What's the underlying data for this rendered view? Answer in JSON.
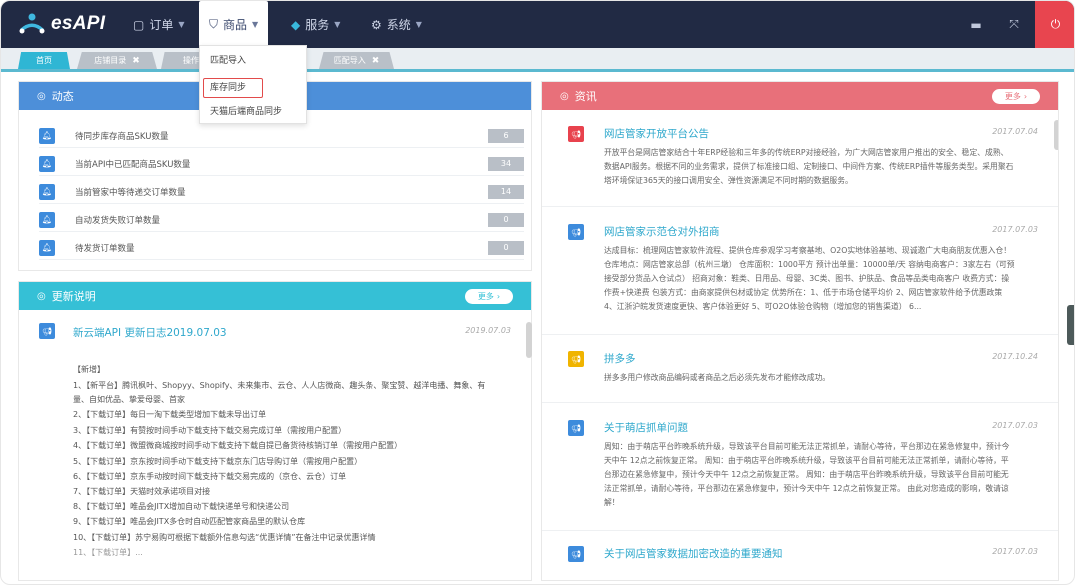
{
  "app": {
    "title": "esAPI"
  },
  "nav": {
    "orders": "订单",
    "goods": "商品",
    "services": "服务",
    "system": "系统"
  },
  "tabs": {
    "home": "首页",
    "shop": "店铺目录",
    "op": "操作",
    "match": "匹配导入"
  },
  "goods_menu": {
    "items": [
      "匹配导入",
      "库存同步",
      "天猫后端商品同步"
    ]
  },
  "dynamic": {
    "title": "动态",
    "rows": [
      {
        "label": "待同步库存商品SKU数量",
        "count": "6"
      },
      {
        "label": "当前API中已匹配商品SKU数量",
        "count": "34"
      },
      {
        "label": "当前管家中等待递交订单数量",
        "count": "14"
      },
      {
        "label": "自动发货失败订单数量",
        "count": "0"
      },
      {
        "label": "待发货订单数量",
        "count": "0"
      }
    ]
  },
  "changelog": {
    "title": "更新说明",
    "more": "更多",
    "entry_title": "新云端API 更新日志2019.07.03",
    "entry_date": "2019.07.03",
    "lines": [
      "【新增】",
      "1、【新平台】腾讯枫叶、Shopyy、Shopify、未来集市、云仓、人人店微商、趣头条、聚宝赞、越洋电播、舞象、有",
      "量、自如优品、挚爱母婴、首家",
      "2、【下载订单】每日一淘下载类型增加下载未导出订单",
      "3、【下载订单】有赞按时间手动下载支持下载交易完成订单（需按用户配置）",
      "4、【下载订单】微盟微商城按时间手动下载支持下载自提已备货待核销订单（需按用户配置）",
      "5、【下载订单】京东按时间手动下载支持下载京东门店导购订单（需按用户配置）",
      "6、【下载订单】京东手动按时间下载支持下载交易完成的（京仓、云仓）订单",
      "7、【下载订单】天猫时效承诺项目对接",
      "8、【下载订单】唯品会JITX增加自动下载快递单号和快递公司",
      "9、【下载订单】唯品会JITX多仓时自动匹配管家商品里的默认仓库",
      "10、【下载订单】苏宁易购可根据下载额外信息勾选“优惠详情”在备注中记录优惠详情",
      "11、【下载订单】..."
    ]
  },
  "news": {
    "title": "资讯",
    "more": "更多",
    "items": [
      {
        "title": "网店管家开放平台公告",
        "date": "2017.07.04",
        "color": "#e8424d",
        "lines": [
          "开放平台是网店管家结合十年ERP经验和三年多的传统ERP对接经验，为广大网店管家用户推出的安全、稳定、成熟、",
          "数据API服务。根据不同的业务需求，提供了标准接口组、定制接口、中间件方案、传统ERP插件等服务类型。采用聚石",
          "塔环境保证365天的接口调用安全、弹性资源满足不同时期的数据服务。"
        ]
      },
      {
        "title": "网店管家示范仓对外招商",
        "date": "2017.07.03",
        "color": "#3d8bdc",
        "lines": [
          "达成目标：梳理网店管家软件流程、提供仓库参观学习考察基地、O2O实地体验基地、现诚邀广大电商朋友优惠入仓！",
          "仓库地点：网店管家总部（杭州三墩） 仓库面积：1000平方 预计出单量：10000单/天 容纳电商客户：3家左右（可预",
          "接受部分货品入仓试点） 招商对象：鞋类、日用品、母婴、3C类、图书、护肤品、食品等品类电商客户 收费方式：操",
          "作费+快递费 包装方式：由商家提供包材或协定 优势所在：1、低于市场仓储平均价 2、网店管家软件给予优惠政策",
          "4、江浙沪皖发货速度更快、客户体验更好 5、可O2O体验仓购物（增加您的销售渠道） 6..."
        ]
      },
      {
        "title": "拼多多",
        "date": "2017.10.24",
        "color": "#f0b400",
        "lines": [
          "拼多多用户修改商品编码或者商品之后必须先发布才能修改成功。"
        ]
      },
      {
        "title": "关于萌店抓单问题",
        "date": "2017.07.03",
        "color": "#3d8bdc",
        "lines": [
          "周知：由于萌店平台昨晚系统升级，导致该平台目前可能无法正常抓单，请耐心等待，平台那边在紧急修复中，预计今",
          "天中午 12点之前恢复正常。 周知：由于萌店平台昨晚系统升级，导致该平台目前可能无法正常抓单，请耐心等待，平",
          "台那边在紧急修复中，预计今天中午 12点之前恢复正常。 周知：由于萌店平台昨晚系统升级，导致该平台目前可能无",
          "法正常抓单，请耐心等待，平台那边在紧急修复中，预计今天中午 12点之前恢复正常。 由此对您造成的影响，敬请谅",
          "解！"
        ]
      },
      {
        "title": "关于网店管家数据加密改造的重要通知",
        "date": "2017.07.03",
        "color": "#3d8bdc",
        "lines": []
      }
    ]
  },
  "colors": {
    "topbar": "#212a44",
    "accent": "#2fb6d4",
    "dynamic_head": "#4d8fd9",
    "news_head": "#e8707a",
    "power": "#e8454f"
  }
}
